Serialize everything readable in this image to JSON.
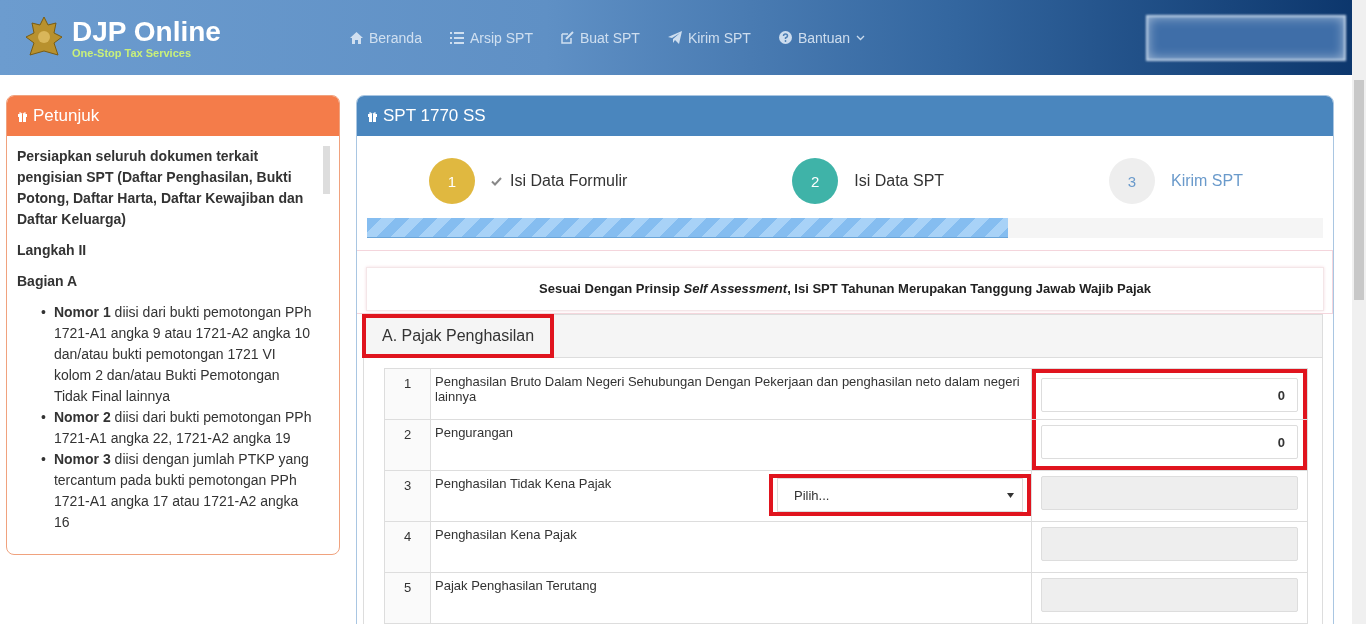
{
  "header": {
    "brand": "DJP Online",
    "tagline": "One-Stop Tax Services",
    "nav": [
      {
        "label": "Beranda",
        "kind": "home",
        "dropdown": false
      },
      {
        "label": "Arsip SPT",
        "kind": "list",
        "dropdown": false
      },
      {
        "label": "Buat SPT",
        "kind": "edit",
        "dropdown": false
      },
      {
        "label": "Kirim SPT",
        "kind": "send",
        "dropdown": false
      },
      {
        "label": "Bantuan",
        "kind": "help",
        "dropdown": true
      }
    ]
  },
  "sidebar": {
    "title": "Petunjuk",
    "intro": "Persiapkan seluruh dokumen terkait pengisian SPT (Daftar Penghasilan, Bukti Potong, Daftar Harta, Daftar Kewajiban dan Daftar Keluarga)",
    "step": "Langkah II",
    "section": "Bagian A",
    "items": [
      {
        "bullet": "•",
        "text": "**Nomor 1** diisi dari bukti pemotongan PPh 1721-A1 angka 9 atau 1721-A2 angka 10 dan/atau bukti pemotongan 1721 VI kolom 2 dan/atau Bukti Pemotongan Tidak Final lainnya"
      },
      {
        "bullet": "•",
        "text": "**Nomor 2** diisi dari bukti pemotongan PPh 1721-A1 angka 22, 1721-A2 angka 19"
      },
      {
        "bullet": "•",
        "text": "**Nomor 3** diisi dengan jumlah PTKP yang tercantum pada bukti pemotongan PPh 1721-A1 angka 17 atau 1721-A2 angka 16"
      }
    ]
  },
  "main": {
    "title": "SPT 1770 SS",
    "steps": [
      {
        "number": "1",
        "label": "Isi Data Formulir",
        "kind": "done"
      },
      {
        "number": "2",
        "label": "Isi Data SPT",
        "kind": "active"
      },
      {
        "number": "3",
        "label": "Kirim SPT",
        "kind": "pending"
      }
    ],
    "progress": {
      "level": 0.67
    },
    "notice": "Sesuai Dengan Prinsip *Self Assessment*, Isi SPT Tahunan Merupakan Tanggung Jawab Wajib Pajak",
    "section": {
      "title": "A. Pajak Penghasilan",
      "highlighted": true
    },
    "rows": [
      {
        "number": "1",
        "label": "Penghasilan Bruto Dalam Negeri Sehubungan Dengan Pekerjaan dan penghasilan neto dalam negeri lainnya",
        "kind": "input",
        "value": "0",
        "highlighted": true
      },
      {
        "number": "2",
        "label": "Pengurangan",
        "kind": "input",
        "value": "0",
        "highlighted": true
      },
      {
        "number": "3",
        "label": "Penghasilan Tidak Kena Pajak",
        "kind": "select",
        "placeholder": "Pilih...",
        "highlighted": true
      },
      {
        "number": "4",
        "label": "Penghasilan Kena Pajak",
        "kind": "readonly",
        "highlighted": false
      },
      {
        "number": "5",
        "label": "Pajak Penghasilan Terutang",
        "kind": "readonly",
        "highlighted": false
      }
    ]
  }
}
